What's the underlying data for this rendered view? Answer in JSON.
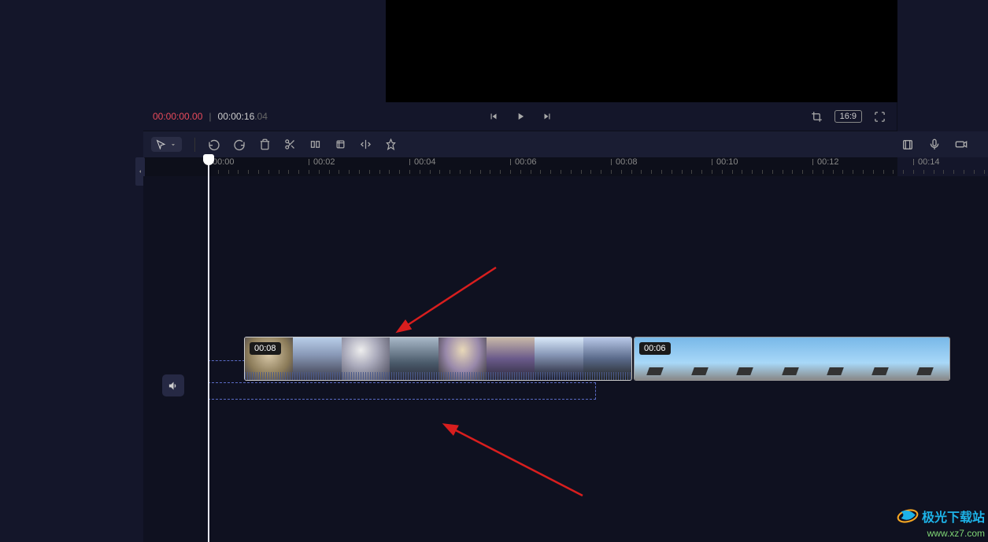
{
  "controls": {
    "current_time": "00:00:00.00",
    "separator": "|",
    "total_time": "00:00:16",
    "total_time_ms": ".04",
    "ratio": "16:9"
  },
  "ruler": {
    "ticks": [
      "00:00",
      "00:02",
      "00:04",
      "00:06",
      "00:08",
      "00:10",
      "00:12",
      "00:14"
    ]
  },
  "clips": [
    {
      "duration_label": "00:08"
    },
    {
      "duration_label": "00:06"
    }
  ],
  "icons": {
    "cursor": "cursor",
    "chevron_down": "chevron-down",
    "undo": "undo",
    "redo": "redo",
    "trash": "trash",
    "scissors": "scissors",
    "split": "split",
    "crop_tool": "crop-tool",
    "mirror": "mirror",
    "pin": "pin",
    "frame": "frame",
    "mic": "mic",
    "camera": "camera",
    "prev": "skip-back",
    "play": "play",
    "next": "skip-forward",
    "crop": "crop",
    "fullscreen": "fullscreen",
    "collapse": "chevron-left",
    "speaker": "speaker"
  },
  "watermark": {
    "name": "极光下载站",
    "url": "www.xz7.com"
  }
}
